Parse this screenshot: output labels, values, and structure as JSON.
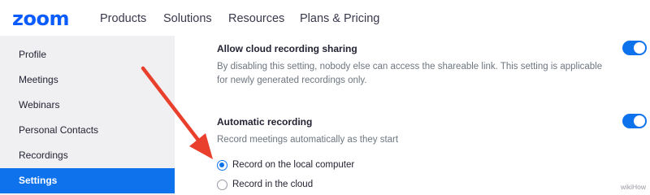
{
  "logo_text": "zoom",
  "nav": {
    "items": [
      "Products",
      "Solutions",
      "Resources",
      "Plans & Pricing"
    ]
  },
  "sidebar": {
    "items": [
      {
        "label": "Profile",
        "active": false
      },
      {
        "label": "Meetings",
        "active": false
      },
      {
        "label": "Webinars",
        "active": false
      },
      {
        "label": "Personal Contacts",
        "active": false
      },
      {
        "label": "Recordings",
        "active": false
      },
      {
        "label": "Settings",
        "active": true
      }
    ]
  },
  "settings": {
    "cloud_sharing": {
      "title": "Allow cloud recording sharing",
      "description": "By disabling this setting, nobody else can access the shareable link. This setting is applicable for newly generated recordings only.",
      "enabled": true
    },
    "automatic_recording": {
      "title": "Automatic recording",
      "description": "Record meetings automatically as they start",
      "enabled": true,
      "options": [
        {
          "label": "Record on the local computer",
          "selected": true
        },
        {
          "label": "Record in the cloud",
          "selected": false
        }
      ]
    }
  },
  "colors": {
    "brand": "#0b5cff",
    "accent": "#0e72ed",
    "annotation_arrow": "#e8402c",
    "sidebar_bg": "#f0f0f3"
  },
  "watermark": "wikiHow"
}
